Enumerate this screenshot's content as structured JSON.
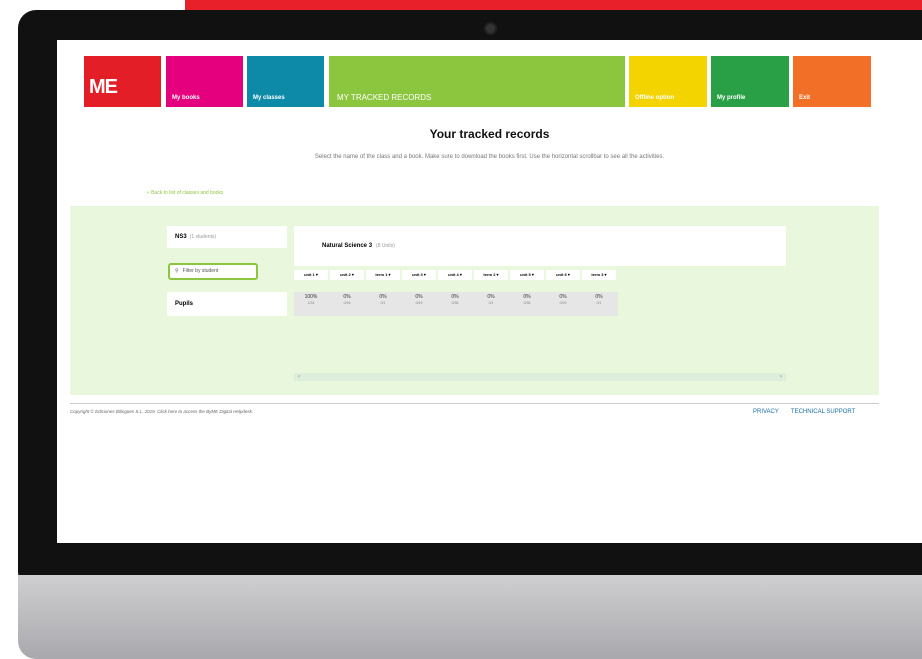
{
  "nav": {
    "logo": "ME",
    "my_books": "My books",
    "my_classes": "My classes",
    "tracked": "MY TRACKED RECORDS",
    "offline": "Offline option",
    "profile": "My profile",
    "exit": "Exit"
  },
  "page": {
    "title": "Your tracked records",
    "instructions": "Select the name of the class and a book. Make sure to download the books first. Use the horizontal scrollbar to see all the activities.",
    "back_link": "« Back to list of classes and books"
  },
  "class": {
    "name": "NS3",
    "count": "(1 students)"
  },
  "filter": {
    "label": "Filter by student"
  },
  "pupils_label": "Pupils",
  "book": {
    "title": "Natural Science 3",
    "units": "(8 Units)"
  },
  "columns": [
    "unit 1",
    "unit 2",
    "term 1",
    "unit 3",
    "unit 4",
    "term 2",
    "unit 5",
    "unit 6",
    "term 3"
  ],
  "values": [
    {
      "pct": "100%",
      "frac": "1/34"
    },
    {
      "pct": "0%",
      "frac": "0/36"
    },
    {
      "pct": "0%",
      "frac": "0/1"
    },
    {
      "pct": "0%",
      "frac": "0/49"
    },
    {
      "pct": "0%",
      "frac": "0/38"
    },
    {
      "pct": "0%",
      "frac": "0/1"
    },
    {
      "pct": "0%",
      "frac": "0/38"
    },
    {
      "pct": "0%",
      "frac": "0/39"
    },
    {
      "pct": "0%",
      "frac": "0/1"
    }
  ],
  "footer": {
    "copyright": "Copyright © Ediciones Bilingües S.L. 2019. Click here to access the ByME Digital Helpdesk.",
    "privacy": "PRIVACY",
    "support": "TECHNICAL SUPPORT"
  }
}
